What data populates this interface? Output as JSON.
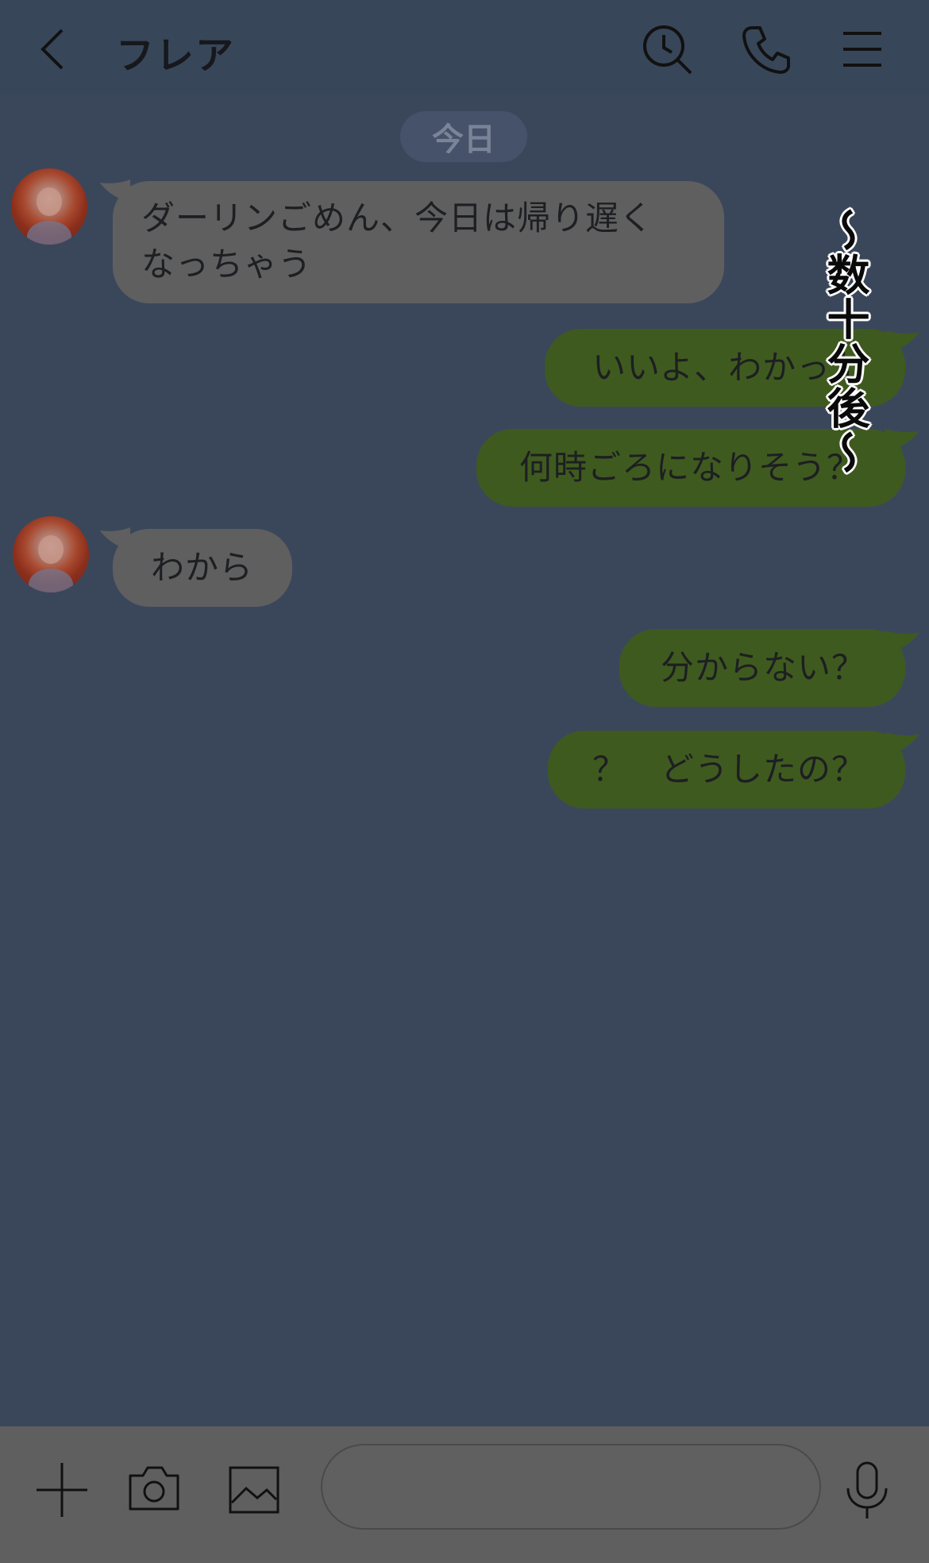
{
  "header": {
    "title": "フレア"
  },
  "date_label": "今日",
  "messages": [
    {
      "side": "in",
      "text": "ダーリンごめん、今日は帰り遅く\nなっちゃう"
    },
    {
      "side": "out",
      "text": "いいよ、わかった"
    },
    {
      "side": "out",
      "text": "何時ごろになりそう？"
    },
    {
      "side": "in",
      "text": "わから"
    },
    {
      "side": "out",
      "text": "分からない？"
    },
    {
      "side": "out",
      "text": "？　どうしたの？"
    }
  ],
  "overlay_text": "〜数十分後〜",
  "colors": {
    "background": "#3a475b",
    "incoming_bubble": "#5f5f60",
    "outgoing_bubble": "#3f5a1f"
  },
  "icons": [
    "back-icon",
    "search-history-icon",
    "phone-icon",
    "menu-icon",
    "plus-icon",
    "camera-icon",
    "image-icon",
    "microphone-icon"
  ]
}
